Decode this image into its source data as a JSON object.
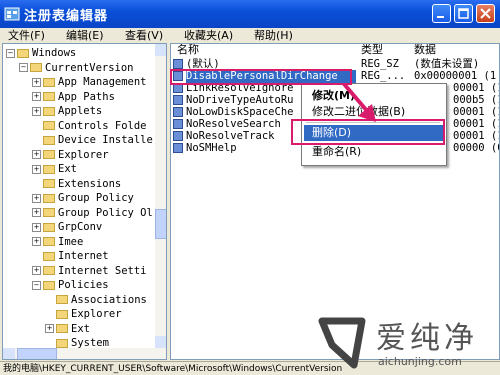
{
  "window": {
    "title": "注册表编辑器"
  },
  "menu": [
    "文件(F)",
    "编辑(E)",
    "查看(V)",
    "收藏夹(A)",
    "帮助(H)"
  ],
  "tree": [
    {
      "label": "Windows",
      "expander": "−",
      "indent": 0
    },
    {
      "label": "CurrentVersion",
      "expander": "−",
      "indent": 1
    },
    {
      "label": "App Management",
      "expander": "+",
      "indent": 2
    },
    {
      "label": "App Paths",
      "expander": "+",
      "indent": 2
    },
    {
      "label": "Applets",
      "expander": "+",
      "indent": 2
    },
    {
      "label": "Controls Folde",
      "expander": "",
      "indent": 2
    },
    {
      "label": "Device Installe",
      "expander": "",
      "indent": 2
    },
    {
      "label": "Explorer",
      "expander": "+",
      "indent": 2
    },
    {
      "label": "Ext",
      "expander": "+",
      "indent": 2
    },
    {
      "label": "Extensions",
      "expander": "",
      "indent": 2
    },
    {
      "label": "Group Policy",
      "expander": "+",
      "indent": 2
    },
    {
      "label": "Group Policy Ol",
      "expander": "+",
      "indent": 2
    },
    {
      "label": "GrpConv",
      "expander": "+",
      "indent": 2
    },
    {
      "label": "Imee",
      "expander": "+",
      "indent": 2
    },
    {
      "label": "Internet",
      "expander": "",
      "indent": 2
    },
    {
      "label": "Internet Setti",
      "expander": "+",
      "indent": 2
    },
    {
      "label": "Policies",
      "expander": "−",
      "indent": 2
    },
    {
      "label": "Associations",
      "expander": "",
      "indent": 3
    },
    {
      "label": "Explorer",
      "expander": "",
      "indent": 3
    },
    {
      "label": "Ext",
      "expander": "+",
      "indent": 3
    },
    {
      "label": "System",
      "expander": "",
      "indent": 3
    }
  ],
  "columns": {
    "name": "名称",
    "type": "类型",
    "data": "数据"
  },
  "values": [
    {
      "name": "(默认)",
      "type": "REG_SZ",
      "data": "(数值未设置)",
      "selected": false
    },
    {
      "name": "DisablePersonalDirChange",
      "type": "REG_...",
      "data": "0x00000001 (1",
      "selected": true
    },
    {
      "name": "LinkResolveIgnore",
      "type": "",
      "data": "00001 (1",
      "selected": false
    },
    {
      "name": "NoDriveTypeAutoRu",
      "type": "",
      "data": "000b5 (1",
      "selected": false
    },
    {
      "name": "NoLowDiskSpaceChe",
      "type": "",
      "data": "00001 (1",
      "selected": false
    },
    {
      "name": "NoResolveSearch",
      "type": "",
      "data": "00001 (1",
      "selected": false
    },
    {
      "name": "NoResolveTrack",
      "type": "",
      "data": "00001 (1",
      "selected": false
    },
    {
      "name": "NoSMHelp",
      "type": "",
      "data": "00000 (0",
      "selected": false
    }
  ],
  "context_menu": {
    "modify": "修改(M)",
    "modify_binary": "修改二进位数据(B)",
    "delete": "删除(D)",
    "rename": "重命名(R)"
  },
  "status": {
    "path": "我的电脑\\HKEY_CURRENT_USER\\Software\\Microsoft\\Windows\\CurrentVersion"
  },
  "watermark": {
    "text": "爱纯净",
    "url": "aichunjing.com"
  },
  "colors": {
    "highlight_box": "#d81b6a",
    "selection": "#316ac5",
    "title_bar": "#0a4fd8"
  }
}
